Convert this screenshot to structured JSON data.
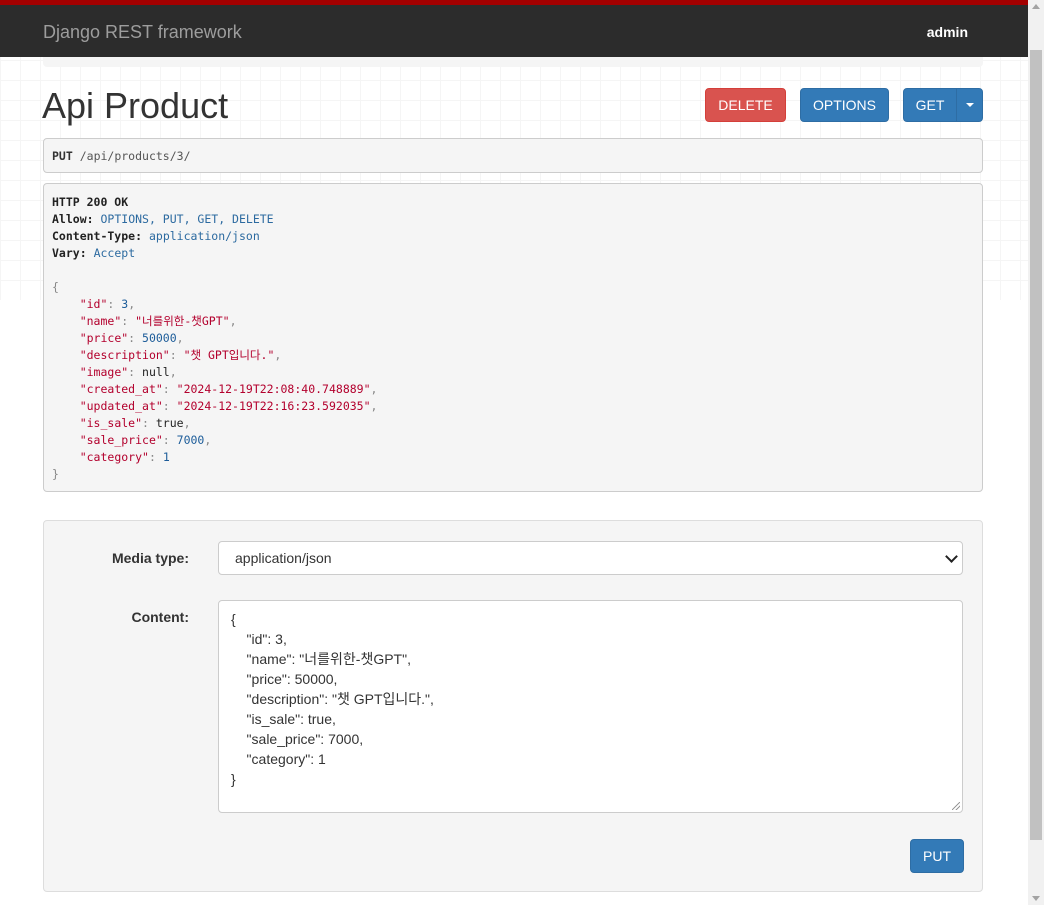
{
  "navbar": {
    "brand": "Django REST framework",
    "user": "admin",
    "accent_color": "#a30000",
    "bg_color": "#2c2c2c"
  },
  "page": {
    "title": "Api Product"
  },
  "actions": {
    "delete_label": "DELETE",
    "options_label": "OPTIONS",
    "get_label": "GET",
    "get_dropdown_icon": "caret-down-icon"
  },
  "request": {
    "method": "PUT",
    "path": "/api/products/3/"
  },
  "response": {
    "status": "HTTP 200 OK",
    "headers": [
      {
        "key": "Allow",
        "value": "OPTIONS, PUT, GET, DELETE"
      },
      {
        "key": "Content-Type",
        "value": "application/json"
      },
      {
        "key": "Vary",
        "value": "Accept"
      }
    ],
    "open_brace": "{",
    "close_brace": "}",
    "fields": [
      {
        "key": "\"id\"",
        "value": "3",
        "type": "num"
      },
      {
        "key": "\"name\"",
        "value": "\"너를위한-챗GPT\"",
        "type": "str"
      },
      {
        "key": "\"price\"",
        "value": "50000",
        "type": "num"
      },
      {
        "key": "\"description\"",
        "value": "\"챗 GPT입니다.\"",
        "type": "str"
      },
      {
        "key": "\"image\"",
        "value": "null",
        "type": "lit"
      },
      {
        "key": "\"created_at\"",
        "value": "\"2024-12-19T22:08:40.748889\"",
        "type": "str"
      },
      {
        "key": "\"updated_at\"",
        "value": "\"2024-12-19T22:16:23.592035\"",
        "type": "str"
      },
      {
        "key": "\"is_sale\"",
        "value": "true",
        "type": "lit"
      },
      {
        "key": "\"sale_price\"",
        "value": "7000",
        "type": "num"
      },
      {
        "key": "\"category\"",
        "value": "1",
        "type": "num"
      }
    ]
  },
  "form": {
    "media_type_label": "Media type:",
    "media_type_value": "application/json",
    "content_label": "Content:",
    "content_lines": [
      "{",
      "    \"id\": 3,",
      "    \"name\": \"너를위한-챗GPT\",",
      "    \"price\": 50000,",
      "    \"description\": \"챗 GPT입니다.\",",
      "    \"is_sale\": true,",
      "    \"sale_price\": 7000,",
      "    \"category\": 1",
      "}"
    ],
    "put_label": "PUT"
  }
}
